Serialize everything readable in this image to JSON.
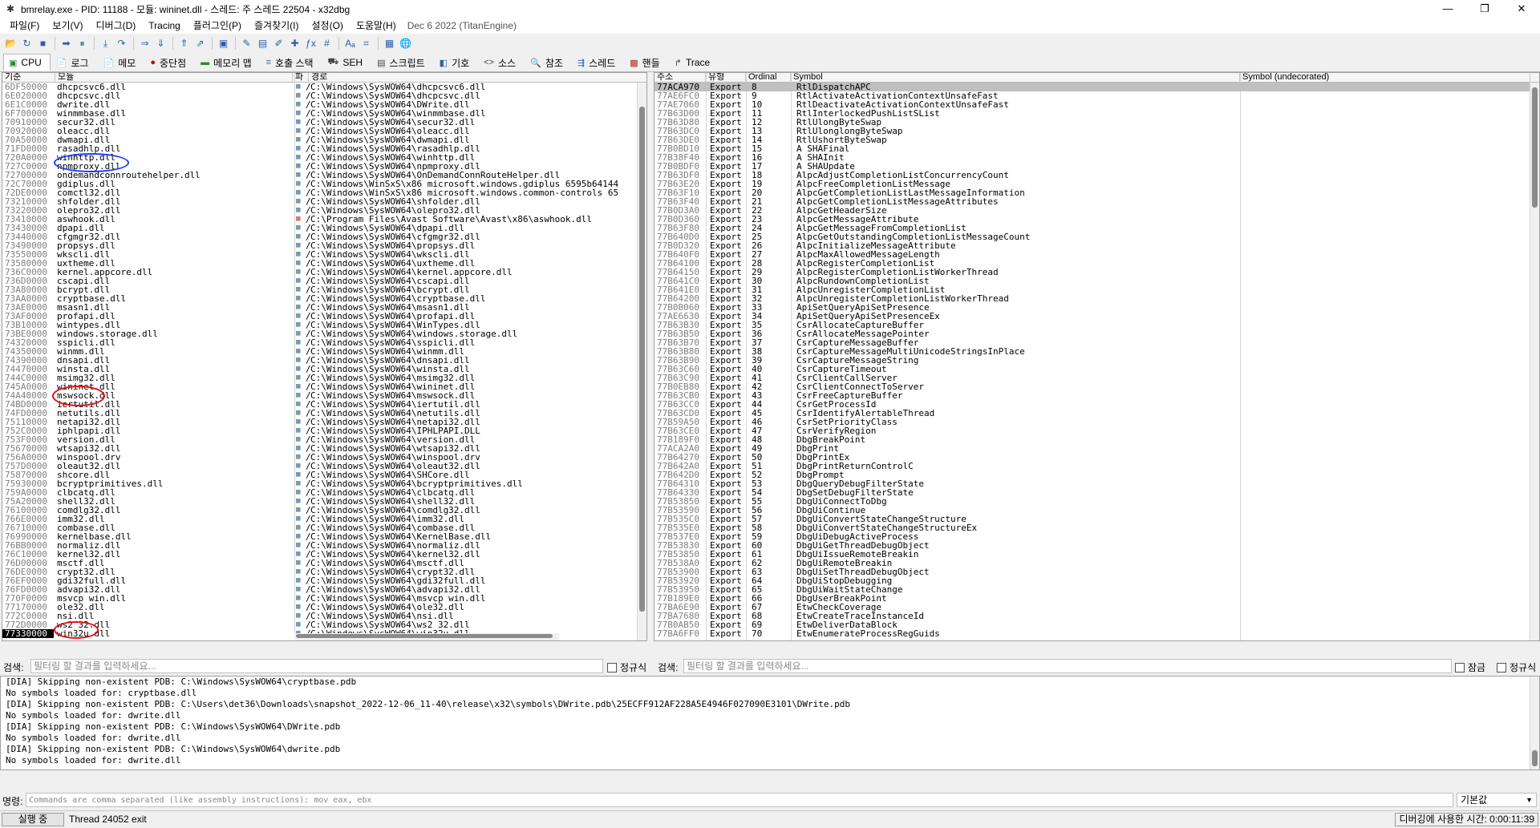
{
  "window": {
    "title": "bmrelay.exe - PID: 11188 - 모듈: wininet.dll - 스레드: 주 스레드 22504 - x32dbg",
    "minimize": "—",
    "maximize": "❐",
    "close": "✕"
  },
  "menu": [
    "파일(F)",
    "보기(V)",
    "디버그(D)",
    "Tracing",
    "플러그인(P)",
    "즐겨찾기(I)",
    "설정(O)",
    "도움말(H)"
  ],
  "build_stamp": "Dec 6 2022 (TitanEngine)",
  "toolbar_icons": [
    {
      "name": "open-icon",
      "glyph": "📂"
    },
    {
      "name": "restart-icon",
      "glyph": "↻"
    },
    {
      "name": "stop-icon",
      "glyph": "■"
    },
    {
      "sep": true
    },
    {
      "name": "run-icon",
      "glyph": "➡"
    },
    {
      "name": "pause-icon",
      "glyph": "⏸"
    },
    {
      "sep": true
    },
    {
      "name": "step-into-icon",
      "glyph": "⤓"
    },
    {
      "name": "step-over-icon",
      "glyph": "↷"
    },
    {
      "sep": true
    },
    {
      "name": "trace-into-icon",
      "glyph": "⇒"
    },
    {
      "name": "trace-over-icon",
      "glyph": "⇓"
    },
    {
      "sep": true
    },
    {
      "name": "execute-till-return-icon",
      "glyph": "⇑"
    },
    {
      "name": "run-to-user-code-icon",
      "glyph": "⇗"
    },
    {
      "sep": true
    },
    {
      "name": "scylla-icon",
      "glyph": "▣"
    },
    {
      "sep": true
    },
    {
      "name": "patch-icon",
      "glyph": "✎"
    },
    {
      "name": "comments-icon",
      "glyph": "▤"
    },
    {
      "name": "labels-icon",
      "glyph": "✐"
    },
    {
      "name": "bookmarks-icon",
      "glyph": "✚"
    },
    {
      "name": "functions-icon",
      "glyph": "ƒx"
    },
    {
      "name": "hash-icon",
      "glyph": "#"
    },
    {
      "sep": true
    },
    {
      "name": "strings-icon",
      "glyph": "Aₐ"
    },
    {
      "name": "calls-icon",
      "glyph": "⌗"
    },
    {
      "sep": true
    },
    {
      "name": "calculator-icon",
      "glyph": "▦"
    },
    {
      "name": "web-icon",
      "glyph": "🌐"
    }
  ],
  "tabs": [
    {
      "label": "CPU",
      "icon": "cpu-icon",
      "glyph": "▣",
      "color": "#2c8a2c"
    },
    {
      "label": "로그",
      "icon": "log-icon",
      "glyph": "📄",
      "color": "#444"
    },
    {
      "label": "메모",
      "icon": "notes-icon",
      "glyph": "📄",
      "color": "#444"
    },
    {
      "label": "중단점",
      "icon": "breakpoint-icon",
      "glyph": "●",
      "color": "#d00000"
    },
    {
      "label": "메모리 맵",
      "icon": "memory-map-icon",
      "glyph": "▬",
      "color": "#2c8a2c"
    },
    {
      "label": "호출 스택",
      "icon": "call-stack-icon",
      "glyph": "≡",
      "color": "#3a6ea5"
    },
    {
      "label": "SEH",
      "icon": "seh-icon",
      "glyph": "⛟",
      "color": "#444"
    },
    {
      "label": "스크립트",
      "icon": "script-icon",
      "glyph": "▤",
      "color": "#444"
    },
    {
      "label": "기호",
      "icon": "symbols-icon",
      "glyph": "◧",
      "color": "#2a5fb0"
    },
    {
      "label": "소스",
      "icon": "source-icon",
      "glyph": "<>",
      "color": "#444"
    },
    {
      "label": "참조",
      "icon": "references-icon",
      "glyph": "🔍",
      "color": "#444"
    },
    {
      "label": "스레드",
      "icon": "threads-icon",
      "glyph": "⇶",
      "color": "#2a5fb0"
    },
    {
      "label": "핸들",
      "icon": "handles-icon",
      "glyph": "▩",
      "color": "#b02a2a"
    },
    {
      "label": "Trace",
      "icon": "trace-icon",
      "glyph": "↱",
      "color": "#444"
    }
  ],
  "module_headers": {
    "base": "기준",
    "module": "모듈",
    "party": "파",
    "path": "경로"
  },
  "modules": [
    [
      "6DF50000",
      "dhcpcsvc6.dll",
      "C:\\Windows\\SysWOW64\\dhcpcsvc6.dll"
    ],
    [
      "6E020000",
      "dhcpcsvc.dll",
      "C:\\Windows\\SysWOW64\\dhcpcsvc.dll"
    ],
    [
      "6E1C0000",
      "dwrite.dll",
      "C:\\Windows\\SysWOW64\\DWrite.dll"
    ],
    [
      "6F700000",
      "winmmbase.dll",
      "C:\\Windows\\SysWOW64\\winmmbase.dll"
    ],
    [
      "70910000",
      "secur32.dll",
      "C:\\Windows\\SysWOW64\\secur32.dll"
    ],
    [
      "70920000",
      "oleacc.dll",
      "C:\\Windows\\SysWOW64\\oleacc.dll"
    ],
    [
      "70A50000",
      "dwmapi.dll",
      "C:\\Windows\\SysWOW64\\dwmapi.dll"
    ],
    [
      "71FD0000",
      "rasadhlp.dll",
      "C:\\Windows\\SysWOW64\\rasadhlp.dll"
    ],
    [
      "720A0000",
      "winhttp.dll",
      "C:\\Windows\\SysWOW64\\winhttp.dll"
    ],
    [
      "727C0000",
      "npmproxy.dll",
      "C:\\Windows\\SysWOW64\\npmproxy.dll"
    ],
    [
      "72700000",
      "ondemandconnroutehelper.dll",
      "C:\\Windows\\SysWOW64\\OnDemandConnRouteHelper.dll"
    ],
    [
      "72C70000",
      "gdiplus.dll",
      "C:\\Windows\\WinSxS\\x86_microsoft.windows.gdiplus_6595b64144"
    ],
    [
      "72DE0000",
      "comctl32.dll",
      "C:\\Windows\\WinSxS\\x86_microsoft.windows.common-controls_65"
    ],
    [
      "73210000",
      "shfolder.dll",
      "C:\\Windows\\SysWOW64\\shfolder.dll"
    ],
    [
      "73220000",
      "olepro32.dll",
      "C:\\Windows\\SysWOW64\\olepro32.dll"
    ],
    [
      "73410000",
      "aswhook.dll",
      "C:\\Program Files\\Avast Software\\Avast\\x86\\aswhook.dll"
    ],
    [
      "73430000",
      "dpapi.dll",
      "C:\\Windows\\SysWOW64\\dpapi.dll"
    ],
    [
      "73440000",
      "cfgmgr32.dll",
      "C:\\Windows\\SysWOW64\\cfgmgr32.dll"
    ],
    [
      "73490000",
      "propsys.dll",
      "C:\\Windows\\SysWOW64\\propsys.dll"
    ],
    [
      "73550000",
      "wkscli.dll",
      "C:\\Windows\\SysWOW64\\wkscli.dll"
    ],
    [
      "73580000",
      "uxtheme.dll",
      "C:\\Windows\\SysWOW64\\uxtheme.dll"
    ],
    [
      "736C0000",
      "kernel.appcore.dll",
      "C:\\Windows\\SysWOW64\\kernel.appcore.dll"
    ],
    [
      "736D0000",
      "cscapi.dll",
      "C:\\Windows\\SysWOW64\\cscapi.dll"
    ],
    [
      "73A80000",
      "bcrypt.dll",
      "C:\\Windows\\SysWOW64\\bcrypt.dll"
    ],
    [
      "73AA0000",
      "cryptbase.dll",
      "C:\\Windows\\SysWOW64\\cryptbase.dll"
    ],
    [
      "73AE0000",
      "msasn1.dll",
      "C:\\Windows\\SysWOW64\\msasn1.dll"
    ],
    [
      "73AF0000",
      "profapi.dll",
      "C:\\Windows\\SysWOW64\\profapi.dll"
    ],
    [
      "73B10000",
      "wintypes.dll",
      "C:\\Windows\\SysWOW64\\WinTypes.dll"
    ],
    [
      "73BE0000",
      "windows.storage.dll",
      "C:\\Windows\\SysWOW64\\windows.storage.dll"
    ],
    [
      "74320000",
      "sspicli.dll",
      "C:\\Windows\\SysWOW64\\sspicli.dll"
    ],
    [
      "74350000",
      "winmm.dll",
      "C:\\Windows\\SysWOW64\\winmm.dll"
    ],
    [
      "74390000",
      "dnsapi.dll",
      "C:\\Windows\\SysWOW64\\dnsapi.dll"
    ],
    [
      "74470000",
      "winsta.dll",
      "C:\\Windows\\SysWOW64\\winsta.dll"
    ],
    [
      "744C0000",
      "msimg32.dll",
      "C:\\Windows\\SysWOW64\\msimg32.dll"
    ],
    [
      "745A0000",
      "wininet.dll",
      "C:\\Windows\\SysWOW64\\wininet.dll"
    ],
    [
      "74A40000",
      "mswsock.dll",
      "C:\\Windows\\SysWOW64\\mswsock.dll"
    ],
    [
      "74BD0000",
      "iertutil.dll",
      "C:\\Windows\\SysWOW64\\iertutil.dll"
    ],
    [
      "74FD0000",
      "netutils.dll",
      "C:\\Windows\\SysWOW64\\netutils.dll"
    ],
    [
      "75110000",
      "netapi32.dll",
      "C:\\Windows\\SysWOW64\\netapi32.dll"
    ],
    [
      "752C0000",
      "iphlpapi.dll",
      "C:\\Windows\\SysWOW64\\IPHLPAPI.DLL"
    ],
    [
      "753F0000",
      "version.dll",
      "C:\\Windows\\SysWOW64\\version.dll"
    ],
    [
      "75670000",
      "wtsapi32.dll",
      "C:\\Windows\\SysWOW64\\wtsapi32.dll"
    ],
    [
      "756A0000",
      "winspool.drv",
      "C:\\Windows\\SysWOW64\\winspool.drv"
    ],
    [
      "757D0000",
      "oleaut32.dll",
      "C:\\Windows\\SysWOW64\\oleaut32.dll"
    ],
    [
      "75870000",
      "shcore.dll",
      "C:\\Windows\\SysWOW64\\SHCore.dll"
    ],
    [
      "75930000",
      "bcryptprimitives.dll",
      "C:\\Windows\\SysWOW64\\bcryptprimitives.dll"
    ],
    [
      "759A0000",
      "clbcatq.dll",
      "C:\\Windows\\SysWOW64\\clbcatq.dll"
    ],
    [
      "75A20000",
      "shell32.dll",
      "C:\\Windows\\SysWOW64\\shell32.dll"
    ],
    [
      "76100000",
      "comdlg32.dll",
      "C:\\Windows\\SysWOW64\\comdlg32.dll"
    ],
    [
      "766E0000",
      "imm32.dll",
      "C:\\Windows\\SysWOW64\\imm32.dll"
    ],
    [
      "76710000",
      "combase.dll",
      "C:\\Windows\\SysWOW64\\combase.dll"
    ],
    [
      "76990000",
      "kernelbase.dll",
      "C:\\Windows\\SysWOW64\\KernelBase.dll"
    ],
    [
      "76BB0000",
      "normaliz.dll",
      "C:\\Windows\\SysWOW64\\normaliz.dll"
    ],
    [
      "76C10000",
      "kernel32.dll",
      "C:\\Windows\\SysWOW64\\kernel32.dll"
    ],
    [
      "76D00000",
      "msctf.dll",
      "C:\\Windows\\SysWOW64\\msctf.dll"
    ],
    [
      "76DE0000",
      "crypt32.dll",
      "C:\\Windows\\SysWOW64\\crypt32.dll"
    ],
    [
      "76EF0000",
      "gdi32full.dll",
      "C:\\Windows\\SysWOW64\\gdi32full.dll"
    ],
    [
      "76FD0000",
      "advapi32.dll",
      "C:\\Windows\\SysWOW64\\advapi32.dll"
    ],
    [
      "770F0000",
      "msvcp_win.dll",
      "C:\\Windows\\SysWOW64\\msvcp_win.dll"
    ],
    [
      "77170000",
      "ole32.dll",
      "C:\\Windows\\SysWOW64\\ole32.dll"
    ],
    [
      "772C0000",
      "nsi.dll",
      "C:\\Windows\\SysWOW64\\nsi.dll"
    ],
    [
      "772D0000",
      "ws2_32.dll",
      "C:\\Windows\\SysWOW64\\ws2_32.dll"
    ],
    [
      "77330000",
      "win32u.dll",
      "C:\\Windows\\SysWOW64\\win32u.dll"
    ]
  ],
  "selected_module_index": 62,
  "symbol_headers": {
    "address": "주소",
    "type": "유형",
    "ordinal": "Ordinal",
    "symbol": "Symbol",
    "undecorated": "Symbol (undecorated)"
  },
  "symbols": [
    [
      "77ACA970",
      "Export",
      "8",
      "RtlDispatchAPC"
    ],
    [
      "77AE6FC0",
      "Export",
      "9",
      "RtlActivateActivationContextUnsafeFast"
    ],
    [
      "77AE7060",
      "Export",
      "10",
      "RtlDeactivateActivationContextUnsafeFast"
    ],
    [
      "77B63D00",
      "Export",
      "11",
      "RtlInterlockedPushListSList"
    ],
    [
      "77B63D80",
      "Export",
      "12",
      "RtlUlongByteSwap"
    ],
    [
      "77B63DC0",
      "Export",
      "13",
      "RtlUlonglongByteSwap"
    ],
    [
      "77B63DE0",
      "Export",
      "14",
      "RtlUshortByteSwap"
    ],
    [
      "77B0BD10",
      "Export",
      "15",
      "A_SHAFinal"
    ],
    [
      "77B38F40",
      "Export",
      "16",
      "A_SHAInit"
    ],
    [
      "77B0BDF0",
      "Export",
      "17",
      "A_SHAUpdate"
    ],
    [
      "77B63DF0",
      "Export",
      "18",
      "AlpcAdjustCompletionListConcurrencyCount"
    ],
    [
      "77B63E20",
      "Export",
      "19",
      "AlpcFreeCompletionListMessage"
    ],
    [
      "77B63F10",
      "Export",
      "20",
      "AlpcGetCompletionListLastMessageInformation"
    ],
    [
      "77B63F40",
      "Export",
      "21",
      "AlpcGetCompletionListMessageAttributes"
    ],
    [
      "77B0D3A0",
      "Export",
      "22",
      "AlpcGetHeaderSize"
    ],
    [
      "77B0D360",
      "Export",
      "23",
      "AlpcGetMessageAttribute"
    ],
    [
      "77B63F80",
      "Export",
      "24",
      "AlpcGetMessageFromCompletionList"
    ],
    [
      "77B640D0",
      "Export",
      "25",
      "AlpcGetOutstandingCompletionListMessageCount"
    ],
    [
      "77B0D320",
      "Export",
      "26",
      "AlpcInitializeMessageAttribute"
    ],
    [
      "77B640F0",
      "Export",
      "27",
      "AlpcMaxAllowedMessageLength"
    ],
    [
      "77B64100",
      "Export",
      "28",
      "AlpcRegisterCompletionList"
    ],
    [
      "77B64150",
      "Export",
      "29",
      "AlpcRegisterCompletionListWorkerThread"
    ],
    [
      "77B641C0",
      "Export",
      "30",
      "AlpcRundownCompletionList"
    ],
    [
      "77B641E0",
      "Export",
      "31",
      "AlpcUnregisterCompletionList"
    ],
    [
      "77B64200",
      "Export",
      "32",
      "AlpcUnregisterCompletionListWorkerThread"
    ],
    [
      "77B0B060",
      "Export",
      "33",
      "ApiSetQueryApiSetPresence"
    ],
    [
      "77AE6630",
      "Export",
      "34",
      "ApiSetQueryApiSetPresenceEx"
    ],
    [
      "77B63B30",
      "Export",
      "35",
      "CsrAllocateCaptureBuffer"
    ],
    [
      "77B63B50",
      "Export",
      "36",
      "CsrAllocateMessagePointer"
    ],
    [
      "77B63B70",
      "Export",
      "37",
      "CsrCaptureMessageBuffer"
    ],
    [
      "77B63B80",
      "Export",
      "38",
      "CsrCaptureMessageMultiUnicodeStringsInPlace"
    ],
    [
      "77B63B90",
      "Export",
      "39",
      "CsrCaptureMessageString"
    ],
    [
      "77B63C60",
      "Export",
      "40",
      "CsrCaptureTimeout"
    ],
    [
      "77B63C90",
      "Export",
      "41",
      "CsrClientCallServer"
    ],
    [
      "77B0EB80",
      "Export",
      "42",
      "CsrClientConnectToServer"
    ],
    [
      "77B63CB0",
      "Export",
      "43",
      "CsrFreeCaptureBuffer"
    ],
    [
      "77B63CC0",
      "Export",
      "44",
      "CsrGetProcessId"
    ],
    [
      "77B63CD0",
      "Export",
      "45",
      "CsrIdentifyAlertableThread"
    ],
    [
      "77B59A50",
      "Export",
      "46",
      "CsrSetPriorityClass"
    ],
    [
      "77B63CE0",
      "Export",
      "47",
      "CsrVerifyRegion"
    ],
    [
      "77B189F0",
      "Export",
      "48",
      "DbgBreakPoint"
    ],
    [
      "77ACA2A0",
      "Export",
      "49",
      "DbgPrint"
    ],
    [
      "77B64270",
      "Export",
      "50",
      "DbgPrintEx"
    ],
    [
      "77B642A0",
      "Export",
      "51",
      "DbgPrintReturnControlC"
    ],
    [
      "77B642D0",
      "Export",
      "52",
      "DbgPrompt"
    ],
    [
      "77B64310",
      "Export",
      "53",
      "DbgQueryDebugFilterState"
    ],
    [
      "77B64330",
      "Export",
      "54",
      "DbgSetDebugFilterState"
    ],
    [
      "77B53850",
      "Export",
      "55",
      "DbgUiConnectToDbg"
    ],
    [
      "77B53590",
      "Export",
      "56",
      "DbgUiContinue"
    ],
    [
      "77B535C0",
      "Export",
      "57",
      "DbgUiConvertStateChangeStructure"
    ],
    [
      "77B535E0",
      "Export",
      "58",
      "DbgUiConvertStateChangeStructureEx"
    ],
    [
      "77B537E0",
      "Export",
      "59",
      "DbgUiDebugActiveProcess"
    ],
    [
      "77B53830",
      "Export",
      "60",
      "DbgUiGetThreadDebugObject"
    ],
    [
      "77B53850",
      "Export",
      "61",
      "DbgUiIssueRemoteBreakin"
    ],
    [
      "77B538A0",
      "Export",
      "62",
      "DbgUiRemoteBreakin"
    ],
    [
      "77B53900",
      "Export",
      "63",
      "DbgUiSetThreadDebugObject"
    ],
    [
      "77B53920",
      "Export",
      "64",
      "DbgUiStopDebugging"
    ],
    [
      "77B53950",
      "Export",
      "65",
      "DbgUiWaitStateChange"
    ],
    [
      "77B189E0",
      "Export",
      "66",
      "DbgUserBreakPoint"
    ],
    [
      "77BA6E90",
      "Export",
      "67",
      "EtwCheckCoverage"
    ],
    [
      "77BA7680",
      "Export",
      "68",
      "EtwCreateTraceInstanceId"
    ],
    [
      "77B0AB50",
      "Export",
      "69",
      "EtwDeliverDataBlock"
    ],
    [
      "77BA6FF0",
      "Export",
      "70",
      "EtwEnumerateProcessRegGuids"
    ]
  ],
  "search": {
    "label_left": "검색:",
    "placeholder_left": "필터링 할 결과를 입력하세요...",
    "regex_left": "정규식",
    "label_right": "검색:",
    "placeholder_right": "필터링 할 결과를 입력하세요...",
    "lock": "잠금",
    "regex_right": "정규식"
  },
  "log_lines": [
    "[DIA] Skipping non-existent PDB: C:\\Windows\\SysWOW64\\cryptbase.pdb",
    "No symbols loaded for: cryptbase.dll",
    "[DIA] Skipping non-existent PDB: C:\\Users\\det36\\Downloads\\snapshot_2022-12-06_11-40\\release\\x32\\symbols\\DWrite.pdb\\25ECFF912AF228A5E4946F027090E3101\\DWrite.pdb",
    "No symbols loaded for: dwrite.dll",
    "[DIA] Skipping non-existent PDB: C:\\Windows\\SysWOW64\\DWrite.pdb",
    "No symbols loaded for: dwrite.dll",
    "[DIA] Skipping non-existent PDB: C:\\Windows\\SysWOW64\\dwrite.pdb",
    "No symbols loaded for: dwrite.dll"
  ],
  "command": {
    "label": "명령:",
    "placeholder": "Commands are comma separated (like assembly instructions): mov eax, ebx",
    "mode": "기본값"
  },
  "status": {
    "state": "실행 중",
    "message": "Thread 24052 exit",
    "timer": "디버깅에 사용한 시간: 0:00:11:39"
  },
  "colors": {
    "selected_row_bg": "#000000",
    "address_text": "#808080",
    "annotation_blue": "#1a3cff",
    "annotation_red": "#e01010"
  }
}
